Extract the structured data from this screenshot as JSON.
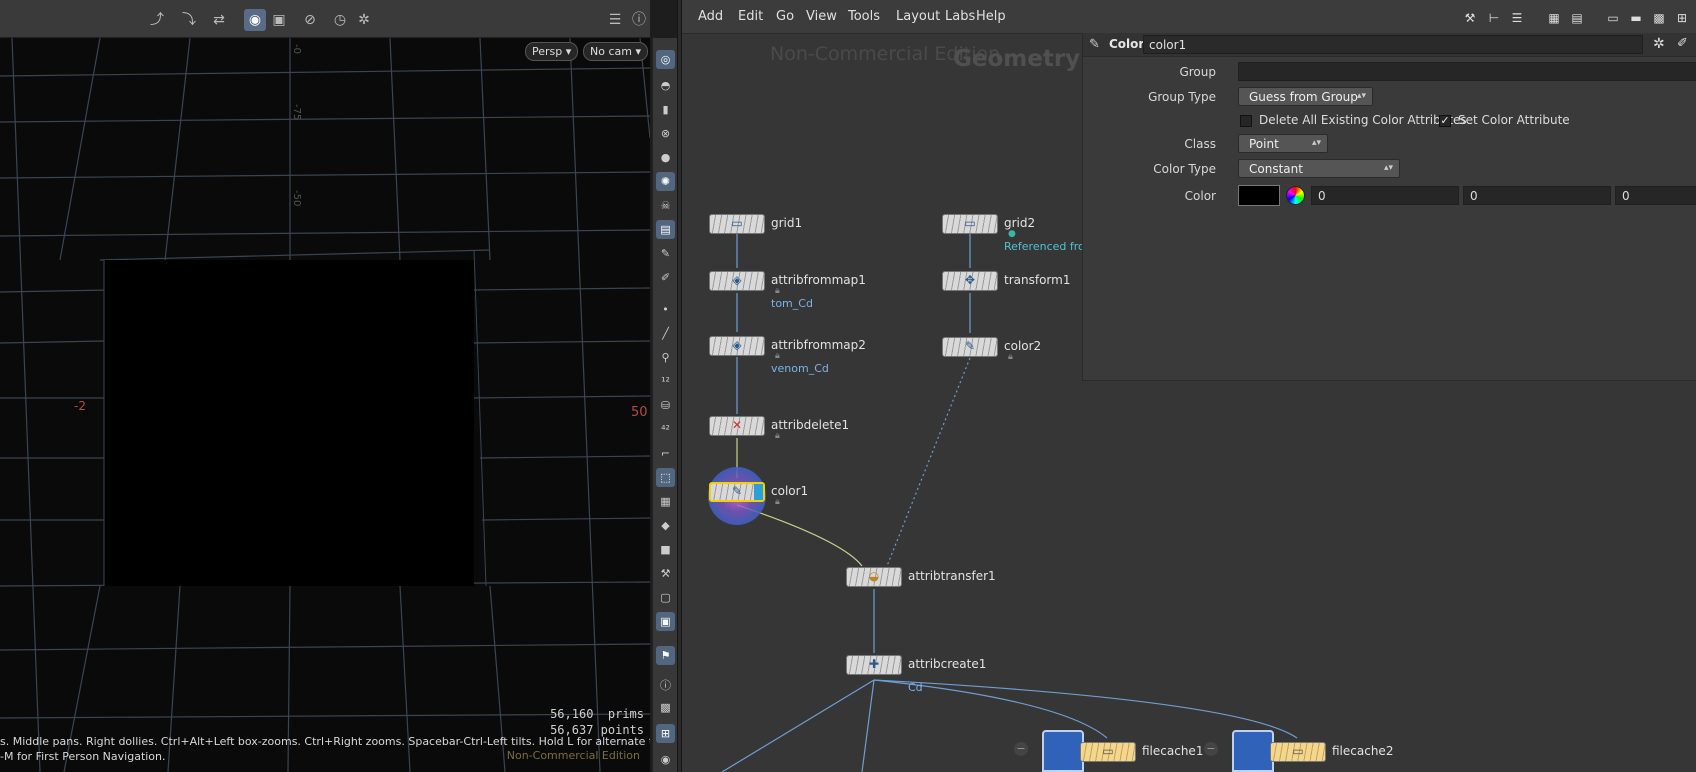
{
  "viewport": {
    "toolbar_icons": [
      "select-pose-icon",
      "handle-icon",
      "transform-icon",
      "view-icon",
      "snapshot-icon",
      "no-entry-icon",
      "timer-icon",
      "settings-icon",
      "display-options-icon",
      "help-icon"
    ],
    "persp_label": "Persp",
    "cam_label": "No cam",
    "grid_labels": {
      "left": "-2",
      "right": "50",
      "top_a": "-0",
      "top_b": "-75",
      "top_c": "-50"
    },
    "stats_prims": "56,160  prims",
    "stats_points": "56,637 points",
    "hint_line1": "s. Middle pans. Right dollies. Ctrl+Alt+Left box-zooms. Ctrl+Right zooms. Spacebar-Ctrl-Left tilts. Hold L for alternate tumble, dolly,",
    "hint_line2": "-M for First Person Navigation.",
    "watermark": "Non-Commercial Edition"
  },
  "menubar": {
    "items": [
      "Add",
      "Edit",
      "Go",
      "View",
      "Tools",
      "Layout",
      "Labs",
      "Help"
    ],
    "right_icons": [
      "tools-icon",
      "tree-icon",
      "list-icon",
      "grid-color-icon",
      "grid-icon",
      "layout-icon",
      "note-icon",
      "image-icon",
      "grid-small-icon"
    ]
  },
  "network": {
    "watermark": "Non-Commercial Edition",
    "context": "Geometry",
    "nodes": {
      "grid1": {
        "name": "grid1"
      },
      "attribfrommap1": {
        "name": "attribfrommap1",
        "sub": "tom_Cd"
      },
      "attribfrommap2": {
        "name": "attribfrommap2",
        "sub": "venom_Cd"
      },
      "attribdelete1": {
        "name": "attribdelete1"
      },
      "color1": {
        "name": "color1"
      },
      "grid2": {
        "name": "grid2",
        "sub": "Referenced from"
      },
      "transform1": {
        "name": "transform1"
      },
      "color2": {
        "name": "color2"
      },
      "attribtransfer1": {
        "name": "attribtransfer1"
      },
      "attribcreate1": {
        "name": "attribcreate1",
        "sub": "Cd"
      },
      "filecache1": {
        "name": "filecache1"
      },
      "filecache2": {
        "name": "filecache2"
      }
    }
  },
  "params": {
    "node_type": "Color",
    "node_name": "color1",
    "group_label": "Group",
    "group_value": "",
    "group_type_label": "Group Type",
    "group_type_value": "Guess from Group",
    "delete_attrs_label": "Delete All Existing Color Attributes",
    "set_color_label": "Set Color Attribute",
    "class_label": "Class",
    "class_value": "Point",
    "color_type_label": "Color Type",
    "color_type_value": "Constant",
    "color_label": "Color",
    "color_r": "0",
    "color_g": "0",
    "color_b": "0",
    "colors": {
      "accent_blue": "#2c9ed8",
      "selected_outline": "#f3d200",
      "swatch": "#000000"
    }
  }
}
